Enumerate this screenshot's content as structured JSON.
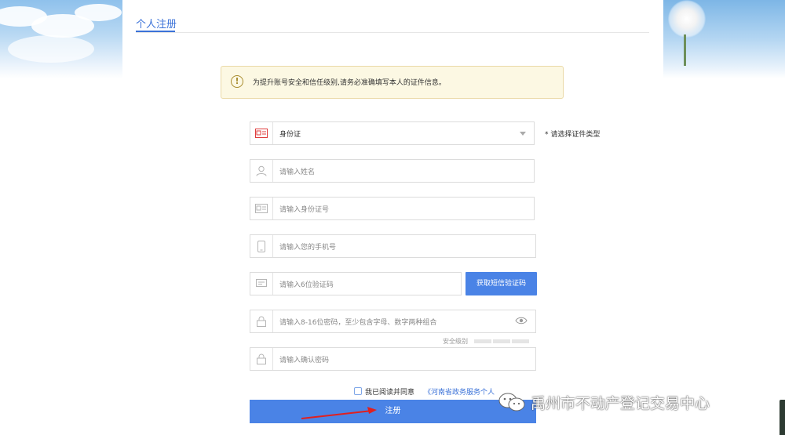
{
  "tab": {
    "title": "个人注册"
  },
  "notice": {
    "text": "为提升账号安全和信任级别,请务必准确填写本人的证件信息。"
  },
  "form": {
    "id_type": {
      "value": "身份证",
      "hint": "* 请选择证件类型"
    },
    "name": {
      "placeholder": "请输入姓名"
    },
    "id_number": {
      "placeholder": "请输入身份证号"
    },
    "phone": {
      "placeholder": "请输入您的手机号"
    },
    "sms_code": {
      "placeholder": "请输入6位验证码",
      "button_label": "获取短信验证码"
    },
    "password": {
      "placeholder": "请输入8-16位密码，至少包含字母、数字两种组合"
    },
    "strength": {
      "label": "安全级别"
    },
    "confirm_password": {
      "placeholder": "请输入确认密码"
    },
    "agreement": {
      "checked": false,
      "text": "我已阅读并同意",
      "link_text": "《河南省政务服务个人"
    },
    "submit_label": "注册"
  },
  "watermark": {
    "text": "禹州市不动产登记交易中心"
  },
  "colors": {
    "accent": "#4a83e6",
    "link": "#3b72d8",
    "notice_bg": "#fcf8e3",
    "arrow": "#e02020"
  }
}
